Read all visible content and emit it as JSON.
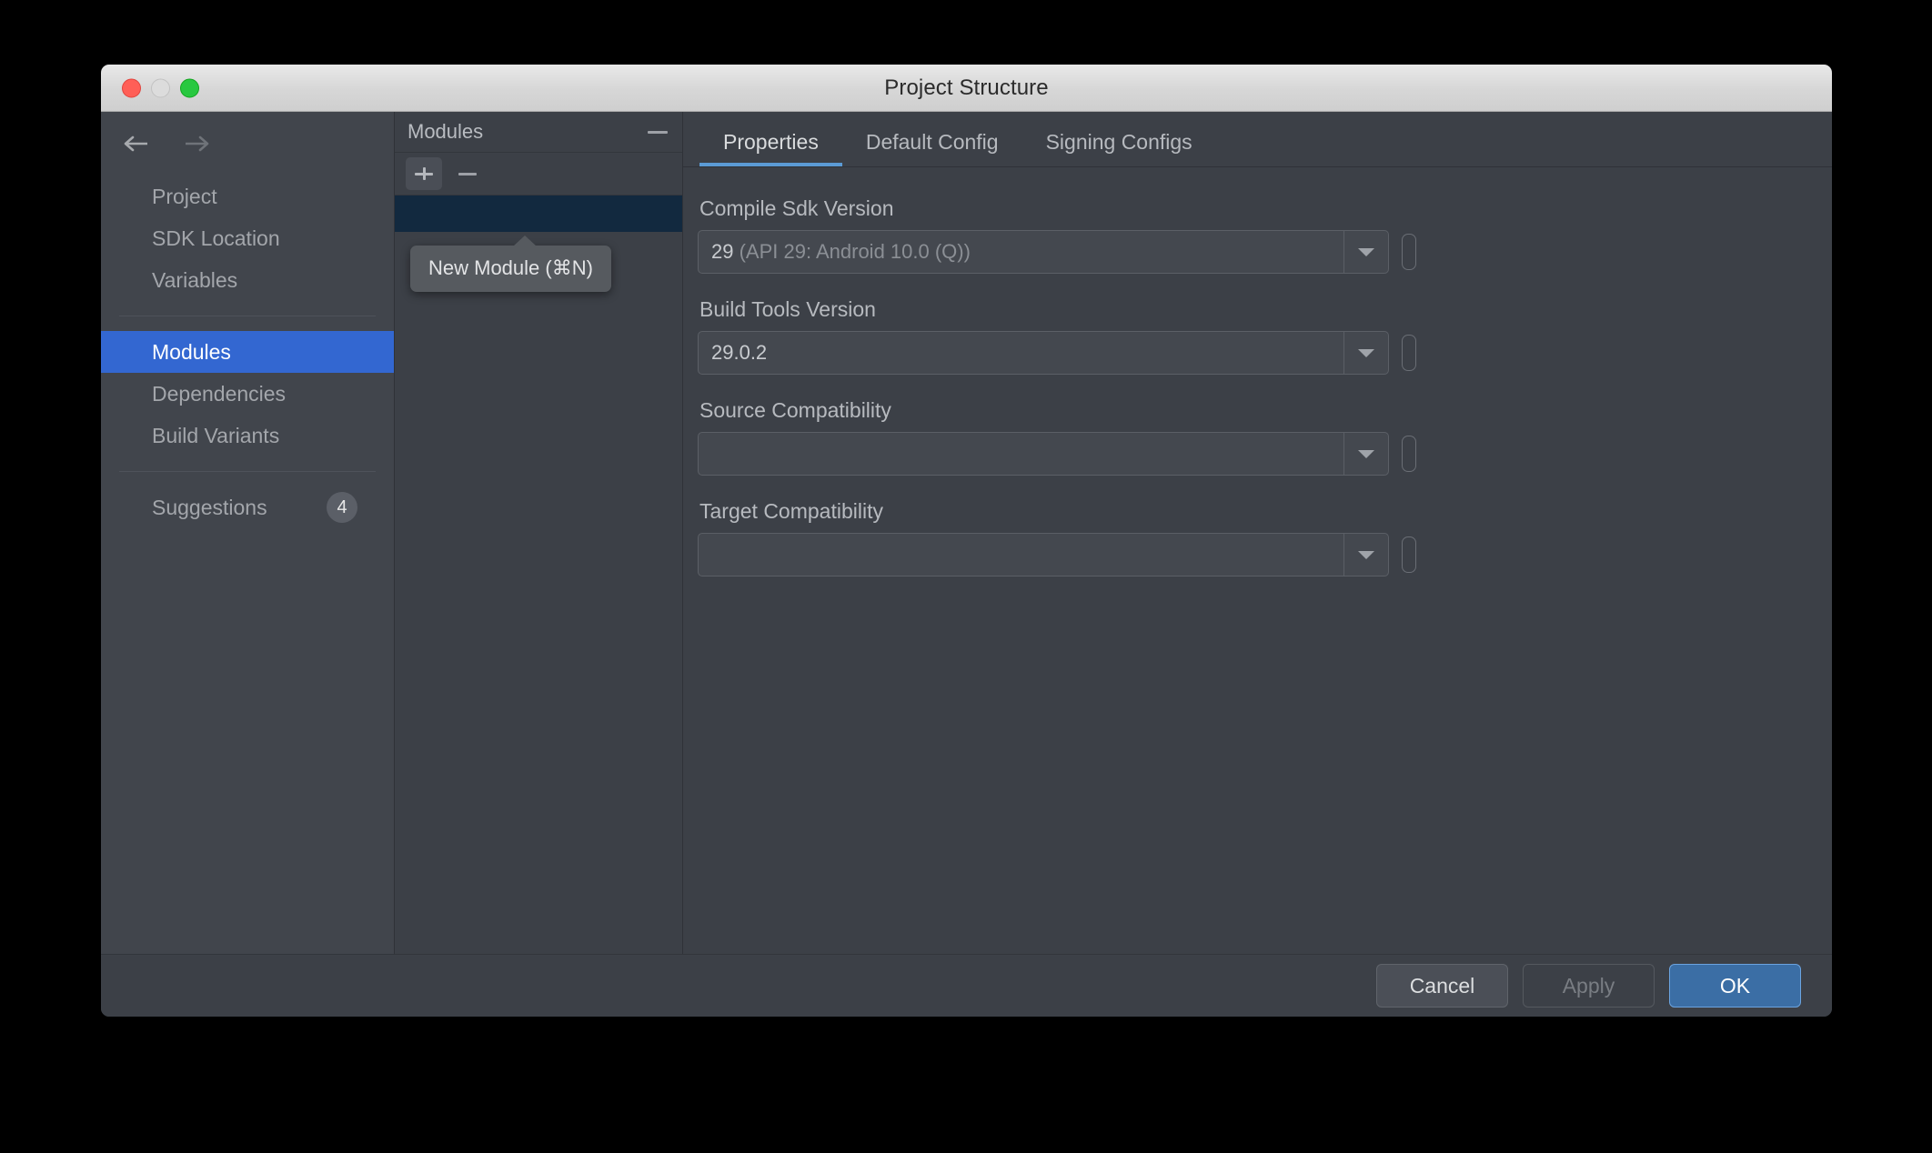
{
  "window": {
    "title": "Project Structure",
    "traffic_lights": [
      "close-button",
      "minimize-button",
      "maximize-button"
    ]
  },
  "sidebar": {
    "back_icon": "back-arrow-icon",
    "forward_icon": "forward-arrow-icon",
    "items": [
      {
        "label": "Project",
        "selected": false
      },
      {
        "label": "SDK Location",
        "selected": false
      },
      {
        "label": "Variables",
        "selected": false
      },
      {
        "label": "Modules",
        "selected": true
      },
      {
        "label": "Dependencies",
        "selected": false
      },
      {
        "label": "Build Variants",
        "selected": false
      }
    ],
    "suggestions": {
      "label": "Suggestions",
      "count": "4"
    }
  },
  "modules_panel": {
    "header": "Modules",
    "collapse_icon": "minimize-dash-icon",
    "add_icon": "plus-icon",
    "remove_icon": "minus-icon",
    "tooltip": "New Module (⌘N)",
    "selected_row": ""
  },
  "tabs": [
    {
      "label": "Properties",
      "active": true
    },
    {
      "label": "Default Config",
      "active": false
    },
    {
      "label": "Signing Configs",
      "active": false
    }
  ],
  "form": {
    "fields": [
      {
        "label": "Compile Sdk Version",
        "value": "29",
        "value_suffix": " (API 29: Android 10.0 (Q))"
      },
      {
        "label": "Build Tools Version",
        "value": "29.0.2",
        "value_suffix": ""
      },
      {
        "label": "Source Compatibility",
        "value": "",
        "value_suffix": ""
      },
      {
        "label": "Target Compatibility",
        "value": "",
        "value_suffix": ""
      }
    ]
  },
  "footer": {
    "cancel": "Cancel",
    "apply": "Apply",
    "ok": "OK"
  },
  "colors": {
    "accent_blue": "#3367d1",
    "tab_underline": "#5b9bd5",
    "ok_button": "#3b6ea5",
    "selected_row": "#12293f",
    "window_bg": "#3c4047"
  }
}
